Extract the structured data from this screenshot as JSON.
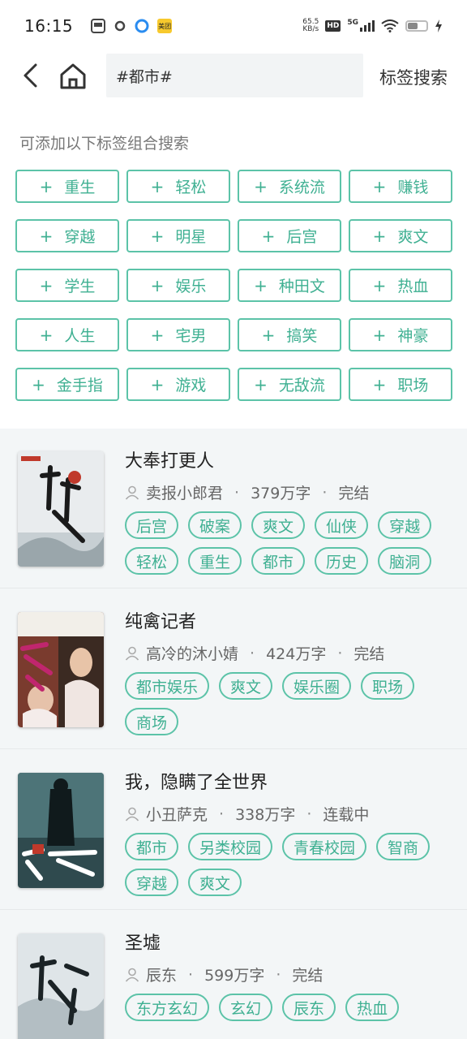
{
  "status_bar": {
    "time": "16:15",
    "net_speed_value": "65.5",
    "net_speed_unit": "KB/s",
    "hd": "HD",
    "signal": "5G",
    "meituan": "美团"
  },
  "nav": {
    "search_value": "#都市#",
    "search_button": "标签搜索"
  },
  "hint": "可添加以下标签组合搜索",
  "tags": [
    "重生",
    "轻松",
    "系统流",
    "赚钱",
    "穿越",
    "明星",
    "后宫",
    "爽文",
    "学生",
    "娱乐",
    "种田文",
    "热血",
    "人生",
    "宅男",
    "搞笑",
    "神豪",
    "金手指",
    "游戏",
    "无敌流",
    "职场"
  ],
  "books": [
    {
      "title": "大奉打更人",
      "author": "卖报小郎君",
      "words": "379万字",
      "status": "完结",
      "tags": [
        "后宫",
        "破案",
        "爽文",
        "仙侠",
        "穿越",
        "轻松",
        "重生",
        "都市",
        "历史",
        "脑洞"
      ]
    },
    {
      "title": "纯禽记者",
      "author": "高冷的沐小婧",
      "words": "424万字",
      "status": "完结",
      "tags": [
        "都市娱乐",
        "爽文",
        "娱乐圈",
        "职场",
        "商场"
      ]
    },
    {
      "title": "我，隐瞒了全世界",
      "author": "小丑萨克",
      "words": "338万字",
      "status": "连载中",
      "tags": [
        "都市",
        "另类校园",
        "青春校园",
        "智商",
        "穿越",
        "爽文"
      ]
    },
    {
      "title": "圣墟",
      "author": "辰东",
      "words": "599万字",
      "status": "完结",
      "tags": [
        "东方玄幻",
        "玄幻",
        "辰东",
        "热血"
      ]
    }
  ],
  "colors": {
    "accent": "#3fb092",
    "accent_border": "#5cc3a8",
    "section_bg": "#f3f6f7"
  }
}
